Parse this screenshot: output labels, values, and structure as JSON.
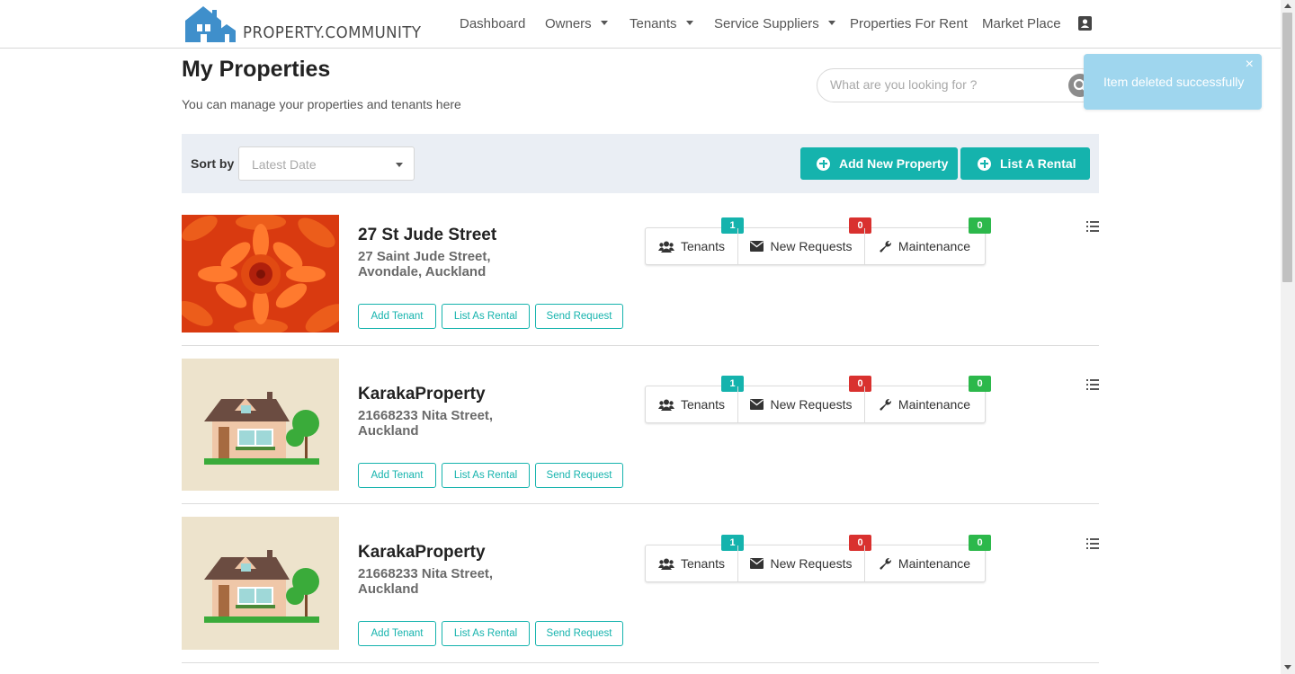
{
  "brand": {
    "name": "PROPERTY.COMMUNITY",
    "accent": "#15b3ad",
    "logo_color": "#3f8fcb"
  },
  "nav": {
    "items": [
      {
        "label": "Dashboard",
        "dropdown": false
      },
      {
        "label": "Owners",
        "dropdown": true
      },
      {
        "label": "Tenants",
        "dropdown": true
      },
      {
        "label": "Service Suppliers",
        "dropdown": true
      },
      {
        "label": "Properties For Rent",
        "dropdown": false
      },
      {
        "label": "Market Place",
        "dropdown": false
      }
    ],
    "user_icon": "user-card-icon"
  },
  "page": {
    "title": "My Properties",
    "subtitle": "You can manage your properties and tenants here"
  },
  "search": {
    "placeholder": "What are you looking for ?",
    "value": ""
  },
  "toast": {
    "message": "Item deleted successfully",
    "close": "×",
    "color": "#9fd6ee"
  },
  "sort": {
    "label": "Sort by :",
    "selected": "Latest Date"
  },
  "actions": {
    "add_property": "Add New Property",
    "list_rental": "List A Rental"
  },
  "row_buttons": {
    "add_tenant": "Add Tenant",
    "list_as_rental": "List As Rental",
    "send_request": "Send Request"
  },
  "stat_labels": {
    "tenants": "Tenants",
    "new_requests": "New Requests",
    "maintenance": "Maintenance"
  },
  "badge_colors": {
    "tenants": "#15b3ad",
    "new_requests": "#d9312f",
    "maintenance": "#2cb84b"
  },
  "properties": [
    {
      "name": "27 St Jude Street",
      "address": "27 Saint Jude Street, Avondale, Auckland",
      "image": "flower-photo",
      "tenants": "1",
      "new_requests": "0",
      "maintenance": "0"
    },
    {
      "name": "KarakaProperty",
      "address": "21668233 Nita Street, Auckland",
      "image": "house-illustration",
      "tenants": "1",
      "new_requests": "0",
      "maintenance": "0"
    },
    {
      "name": "KarakaProperty",
      "address": "21668233 Nita Street, Auckland",
      "image": "house-illustration",
      "tenants": "1",
      "new_requests": "0",
      "maintenance": "0"
    }
  ]
}
